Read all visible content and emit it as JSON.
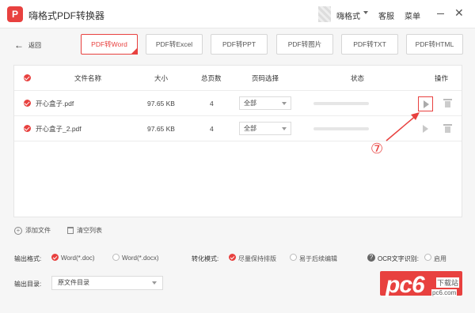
{
  "app": {
    "logo_letter": "P",
    "title": "嗨格式PDF转换器"
  },
  "titlebar": {
    "user": "嗨格式",
    "service": "客服",
    "menu": "菜单",
    "close": "✕"
  },
  "back": {
    "arrow": "←",
    "label": "返回"
  },
  "tabs": [
    {
      "label": "PDF转Word",
      "active": true
    },
    {
      "label": "PDF转Excel"
    },
    {
      "label": "PDF转PPT"
    },
    {
      "label": "PDF转图片"
    },
    {
      "label": "PDF转TXT"
    },
    {
      "label": "PDF转HTML"
    }
  ],
  "table": {
    "headers": {
      "name": "文件名称",
      "size": "大小",
      "pages": "总页数",
      "range": "页码选择",
      "status": "状态",
      "action": "操作"
    },
    "rows": [
      {
        "name": "开心盒子.pdf",
        "size": "97.65 KB",
        "pages": "4",
        "range": "全部"
      },
      {
        "name": "开心盒子_2.pdf",
        "size": "97.65 KB",
        "pages": "4",
        "range": "全部"
      }
    ]
  },
  "annotation": {
    "label": "⑦"
  },
  "actions": {
    "add_file": "添加文件",
    "clear_list": "清空列表"
  },
  "options": {
    "format_label": "输出格式:",
    "format_doc": "Word(*.doc)",
    "format_docx": "Word(*.docx)",
    "mode_label": "转化模式:",
    "mode_keep": "尽量保持排版",
    "mode_edit": "易于后续编辑",
    "ocr_label": "OCR文字识别:",
    "ocr_enable": "启用",
    "help": "?"
  },
  "output": {
    "label": "输出目录:",
    "value": "原文件目录"
  },
  "watermark": {
    "logo": "pc6",
    "sub": "下载站",
    "url": "pc6.com"
  },
  "colors": {
    "accent": "#e8413f"
  }
}
